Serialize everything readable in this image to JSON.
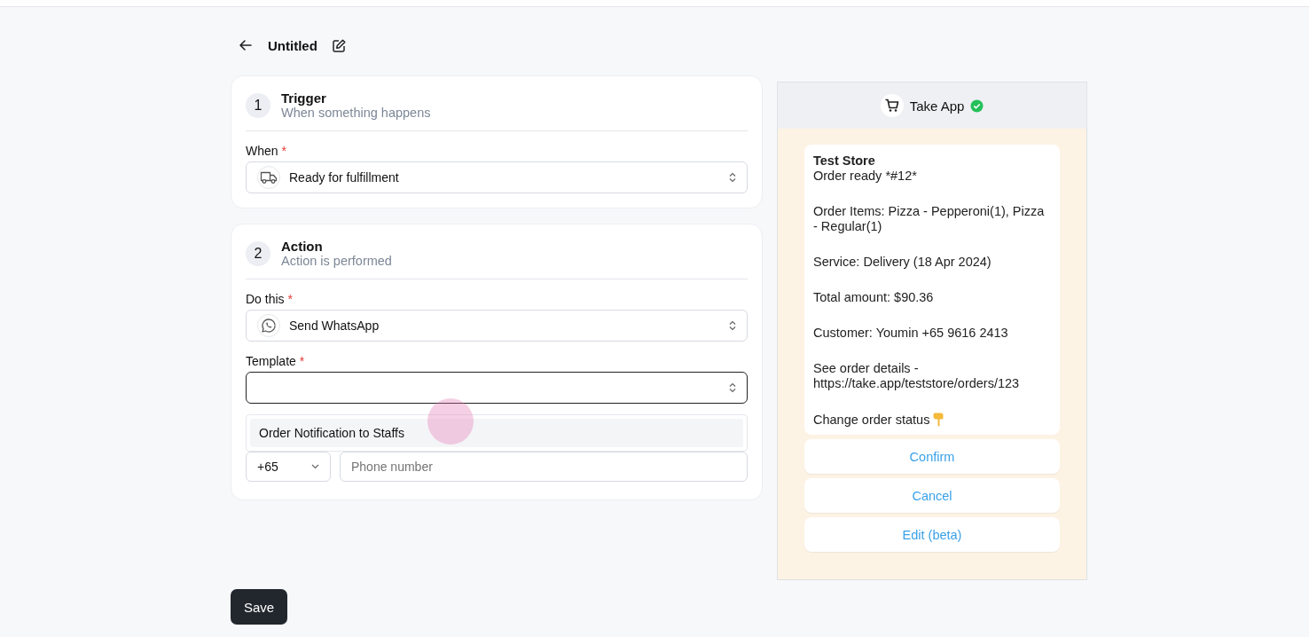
{
  "header": {
    "title": "Untitled"
  },
  "steps": [
    {
      "number": "1",
      "title": "Trigger",
      "subtitle": "When something happens",
      "fields": [
        {
          "kind": "select",
          "label": "When",
          "required_mark": "*",
          "value": "Ready for fulfillment",
          "focused": false
        }
      ]
    },
    {
      "number": "2",
      "title": "Action",
      "subtitle": "Action is performed",
      "fields": [
        {
          "kind": "select",
          "label": "Do this",
          "required_mark": "*",
          "value": "Send WhatsApp",
          "focused": false
        },
        {
          "kind": "select",
          "label": "Template",
          "required_mark": "*",
          "focused": true,
          "options": [
            "Order Notification to Staffs"
          ]
        },
        {
          "kind": "phone",
          "code": "+65",
          "placeholder": "Phone number"
        }
      ]
    }
  ],
  "preview": {
    "app_name": "Take App",
    "verified": true,
    "message": {
      "title": "Test Store",
      "paragraphs": [
        "Order ready *#12*",
        "Order Items: Pizza - Pepperoni(1), Pizza - Regular(1)",
        "Service: Delivery (18 Apr 2024)",
        "Total amount: $90.36",
        "Customer: Youmin +65 9616 2413",
        "See order details -\nhttps://take.app/teststore/orders/123",
        "Change order status"
      ]
    },
    "buttons": [
      "Confirm",
      "Cancel",
      "Edit (beta)"
    ]
  },
  "save_button": "Save"
}
